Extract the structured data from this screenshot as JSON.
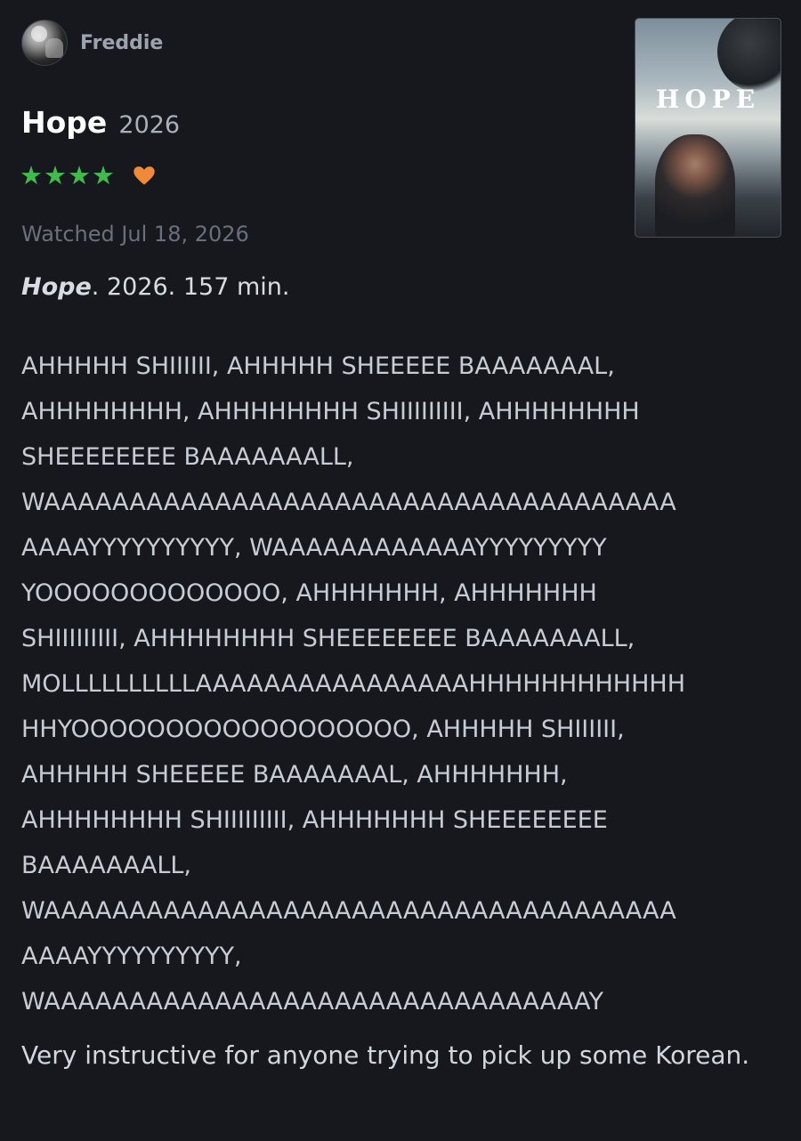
{
  "user": {
    "name": "Freddie",
    "avatar_icon": "avatar"
  },
  "film": {
    "title": "Hope",
    "year": "2026",
    "stars": "★★★★",
    "rating": 4,
    "liked": true,
    "poster_title": "HOPE"
  },
  "colors": {
    "star": "#40bc4c",
    "heart": "#f08a38",
    "background": "#16181d"
  },
  "watched": "Watched Jul 18, 2026",
  "meta": {
    "title": "Hope",
    "rest": ". 2026. 157 min."
  },
  "review_lines": [
    "AHHHHH SHIIIIII, AHHHHH SHEEEEE BAAAAAAAL,",
    "AHHHHHHHH, AHHHHHHHH SHIIIIIIIII, AHHHHHHHH",
    "SHEEEEEEEE BAAAAAAALL,",
    "WAAAAAAAAAAAAAAAAAAAAAAAAAAAAAAAAAAAAA",
    "AAAAYYYYYYYYYY, WAAAAAAAAAAAAYYYYYYYYY",
    "YOOOOOOOOOOOOO, AHHHHHHH, AHHHHHHH",
    "SHIIIIIIIII, AHHHHHHHH SHEEEEEEEE BAAAAAAALL,",
    "MOLLLLLLLLLLAAAAAAAAAAAAAAAAHHHHHHHHHHHH",
    "HHYOOOOOOOOOOOOOOOOOO, AHHHHH SHIIIIII,",
    "AHHHHH SHEEEEE BAAAAAAAL, AHHHHHHH,",
    "AHHHHHHHH SHIIIIIIIII, AHHHHHHH SHEEEEEEEE",
    "BAAAAAAALL,",
    "WAAAAAAAAAAAAAAAAAAAAAAAAAAAAAAAAAAAAA",
    "AAAAYYYYYYYYYY,",
    "WAAAAAAAAAAAAAAAAAAAAAAAAAAAAAAAAY"
  ],
  "note": "Very instructive for anyone trying to pick up some Korean."
}
